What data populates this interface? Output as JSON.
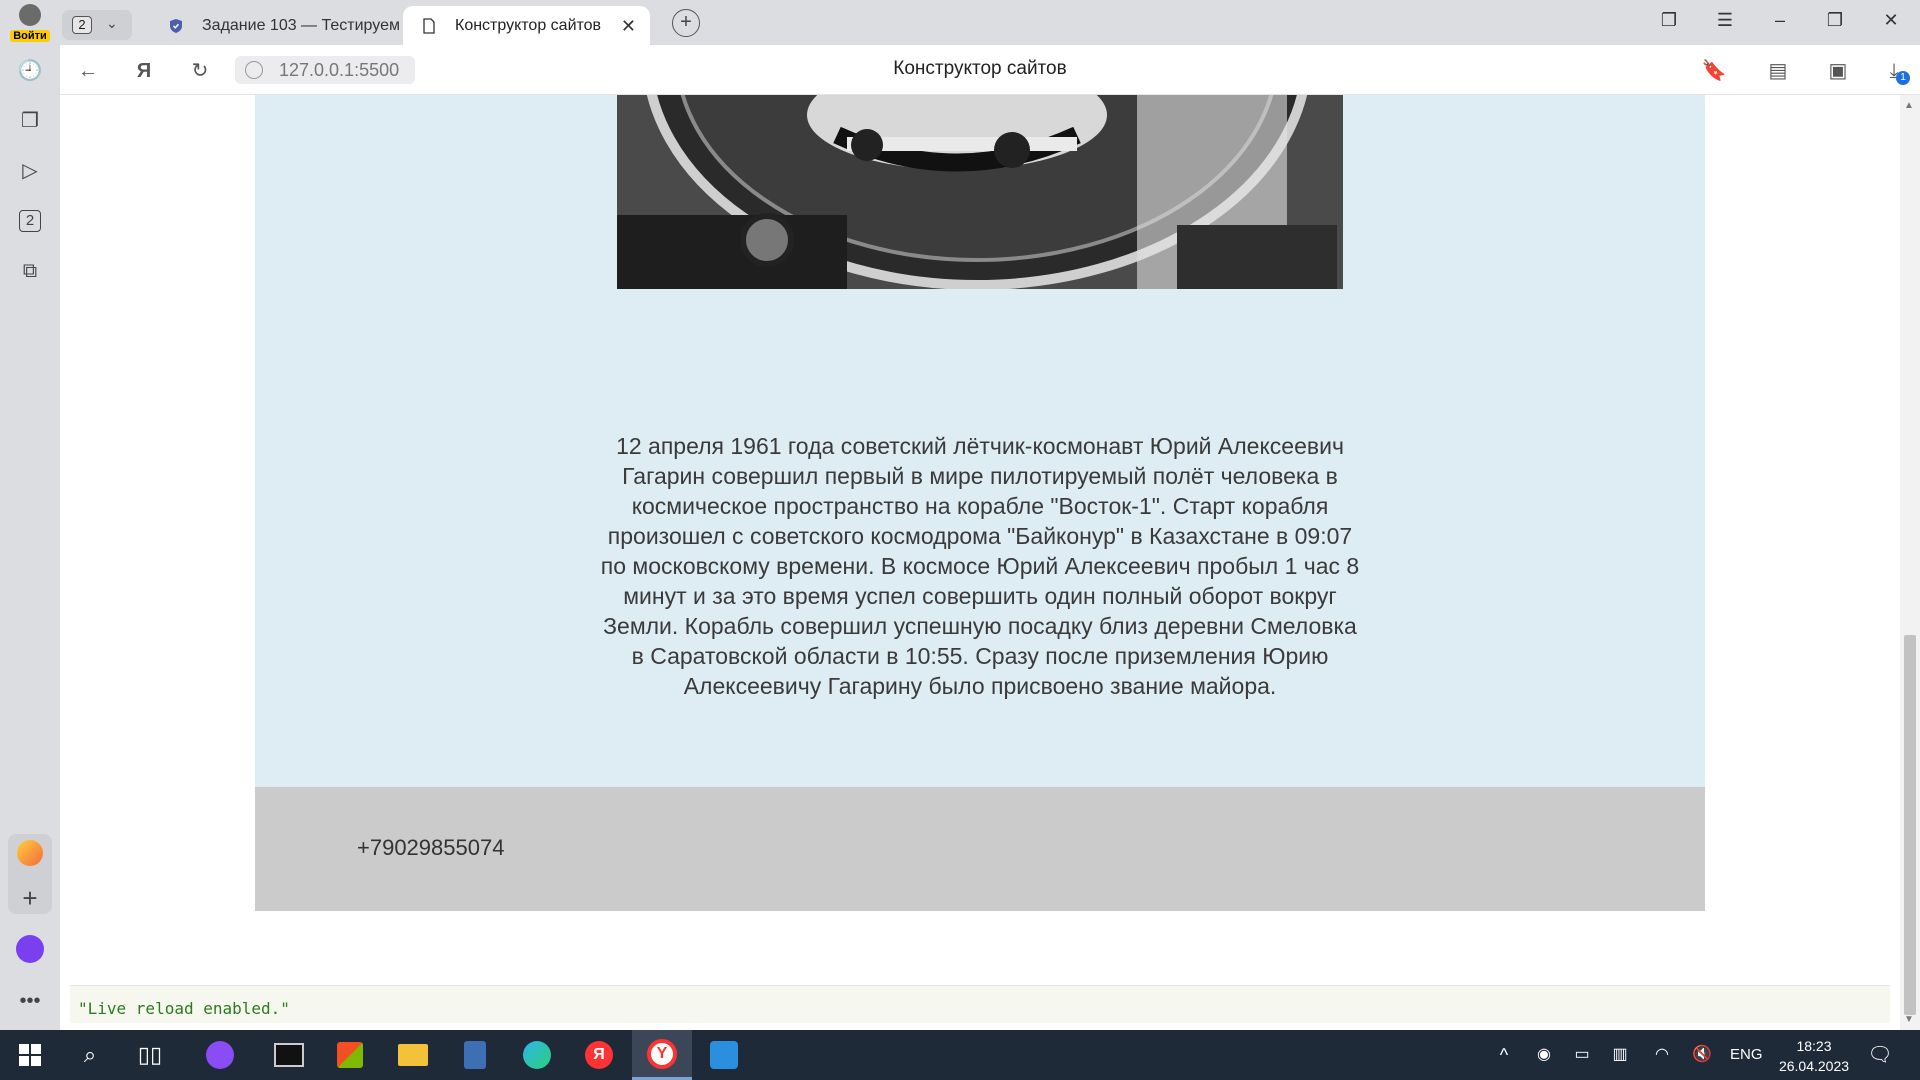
{
  "browser": {
    "login_label": "Войти",
    "tab_count": "2",
    "tabs": [
      {
        "label": "Задание 103 — Тестируем"
      },
      {
        "label": "Конструктор сайтов"
      }
    ],
    "url": "127.0.0.1:5500",
    "page_title": "Конструктор сайтов",
    "sidebar_badge": "2",
    "download_badge": "1"
  },
  "page": {
    "bio": "12 апреля 1961 года советский лётчик-космонавт Юрий Алексеевич Гагарин совершил первый в мире пилотируемый полёт человека в космическое пространство на корабле \"Восток-1\". Старт корабля произошел с советского космодрома \"Байконур\" в Казахстане в 09:07 по московскому времени. В космосе Юрий Алексеевич пробыл 1 час 8 минут и за это время успел совершить один полный оборот вокруг Земли. Корабль совершил успешную посадку близ деревни Смеловка в Саратовской области в 10:55. Сразу после приземления Юрию Алексеевичу Гагарину было присвоено звание майора.",
    "phone": "+79029855074",
    "console_message": "\"Live reload enabled.\""
  },
  "taskbar": {
    "language": "ENG",
    "time": "18:23",
    "date": "26.04.2023"
  },
  "colors": {
    "section_bg": "#deedf4",
    "footer_bg": "#cbcbcb",
    "taskbar_bg": "#1f2a38",
    "console_text": "#2c7a1e"
  }
}
